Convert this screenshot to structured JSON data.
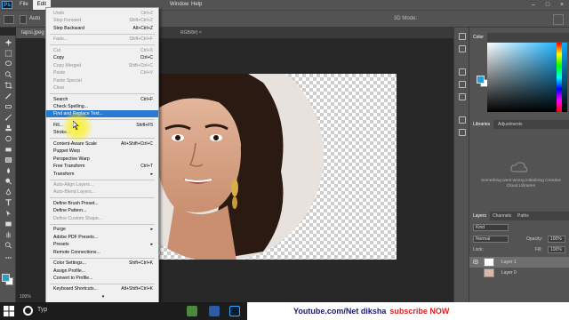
{
  "menubar": {
    "logo": "Ps",
    "items": [
      "File",
      "Edit",
      "",
      "",
      "",
      "",
      "",
      "",
      "",
      "Window",
      "Help"
    ],
    "window_label": "Window",
    "help_label": "Help",
    "file_label": "File",
    "edit_label": "Edit"
  },
  "options": {
    "auto_label": "Auto",
    "mode_3d": "3D Mode:"
  },
  "document": {
    "tab_label": "tapsi.jpeg",
    "tab_suffix": "RGB/8#) ×",
    "zoom": "100%"
  },
  "edit_menu": {
    "items": [
      {
        "label": "Undo",
        "shortcut": "Ctrl+Z",
        "disabled": true
      },
      {
        "label": "Step Forward",
        "shortcut": "Shift+Ctrl+Z",
        "disabled": true
      },
      {
        "label": "Step Backward",
        "shortcut": "Alt+Ctrl+Z",
        "disabled": false
      },
      {
        "label": "Fade...",
        "shortcut": "Shift+Ctrl+F",
        "disabled": true
      },
      {
        "label": "Cut",
        "shortcut": "Ctrl+X",
        "disabled": true
      },
      {
        "label": "Copy",
        "shortcut": "Ctrl+C",
        "disabled": false
      },
      {
        "label": "Copy Merged",
        "shortcut": "Shift+Ctrl+C",
        "disabled": true
      },
      {
        "label": "Paste",
        "shortcut": "Ctrl+V",
        "disabled": true
      },
      {
        "label": "Paste Special",
        "shortcut": "",
        "disabled": true
      },
      {
        "label": "Clear",
        "shortcut": "",
        "disabled": true
      },
      {
        "label": "Search",
        "shortcut": "Ctrl+F",
        "disabled": false
      },
      {
        "label": "Check Spelling...",
        "shortcut": "",
        "disabled": false
      },
      {
        "label": "Find and Replace Text...",
        "shortcut": "",
        "disabled": false,
        "highlighted": true
      },
      {
        "label": "Fill...",
        "shortcut": "Shift+F5",
        "disabled": false
      },
      {
        "label": "Stroke...",
        "shortcut": "",
        "disabled": false
      },
      {
        "label": "Content-Aware Scale",
        "shortcut": "Alt+Shift+Ctrl+C",
        "disabled": false
      },
      {
        "label": "Puppet Warp",
        "shortcut": "",
        "disabled": false
      },
      {
        "label": "Perspective Warp",
        "shortcut": "",
        "disabled": false
      },
      {
        "label": "Free Transform",
        "shortcut": "Ctrl+T",
        "disabled": false
      },
      {
        "label": "Transform",
        "shortcut": "",
        "disabled": false,
        "submenu": true
      },
      {
        "label": "Auto-Align Layers...",
        "shortcut": "",
        "disabled": true
      },
      {
        "label": "Auto-Blend Layers...",
        "shortcut": "",
        "disabled": true
      },
      {
        "label": "Define Brush Preset...",
        "shortcut": "",
        "disabled": false
      },
      {
        "label": "Define Pattern...",
        "shortcut": "",
        "disabled": false
      },
      {
        "label": "Define Custom Shape...",
        "shortcut": "",
        "disabled": true
      },
      {
        "label": "Purge",
        "shortcut": "",
        "disabled": false,
        "submenu": true
      },
      {
        "label": "Adobe PDF Presets...",
        "shortcut": "",
        "disabled": false
      },
      {
        "label": "Presets",
        "shortcut": "",
        "disabled": false,
        "submenu": true
      },
      {
        "label": "Remote Connections...",
        "shortcut": "",
        "disabled": false
      },
      {
        "label": "Color Settings...",
        "shortcut": "Shift+Ctrl+K",
        "disabled": false
      },
      {
        "label": "Assign Profile...",
        "shortcut": "",
        "disabled": false
      },
      {
        "label": "Convert to Profile...",
        "shortcut": "",
        "disabled": false
      },
      {
        "label": "Keyboard Shortcuts...",
        "shortcut": "Alt+Shift+Ctrl+K",
        "disabled": false
      }
    ],
    "more_arrow": "▾"
  },
  "panels": {
    "color_tab": "Color",
    "libraries_tab": "Libraries",
    "adjustments_tab": "Adjustments",
    "library_message": "Something went wrong initializing Creative Cloud Libraries",
    "layers_tab": "Layers",
    "channels_tab": "Channels",
    "paths_tab": "Paths",
    "kind_label": "Kind",
    "blend_mode": "Normal",
    "opacity_label": "Opacity:",
    "opacity_value": "100%",
    "lock_label": "Lock:",
    "fill_label": "Fill:",
    "fill_value": "100%",
    "layers": [
      {
        "name": "Layer 1",
        "selected": true
      },
      {
        "name": "Layer 0",
        "selected": false
      }
    ]
  },
  "taskbar": {
    "search_text": "Typ",
    "banner_text": "Youtube.com/Net diksha",
    "banner_cta": "subscribe NOW"
  },
  "colors": {
    "foreground": "#23a0d0",
    "background": "#ffffff",
    "menu_highlight": "#2a7ad2",
    "banner_text": "#1a1a6a",
    "banner_cta": "#e02020"
  }
}
